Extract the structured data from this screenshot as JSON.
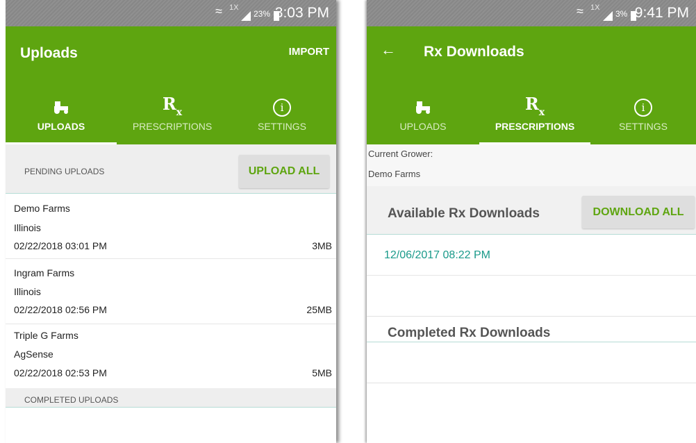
{
  "left": {
    "status": {
      "network": "1X",
      "battery": "23%",
      "time": "3:03 PM"
    },
    "title": "Uploads",
    "import_label": "IMPORT",
    "tabs": [
      {
        "label": "UPLOADS",
        "icon": "tractor-icon",
        "active": true
      },
      {
        "label": "PRESCRIPTIONS",
        "icon": "rx-icon",
        "active": false
      },
      {
        "label": "SETTINGS",
        "icon": "info-icon",
        "active": false
      }
    ],
    "rx_symbol": "R",
    "rx_sub": "x",
    "info_symbol": "i",
    "pending_label": "PENDING UPLOADS",
    "upload_all_label": "UPLOAD ALL",
    "uploads": [
      {
        "farm": "Demo Farms",
        "location": "Illinois",
        "datetime": "02/22/2018 03:01 PM",
        "size": "3MB"
      },
      {
        "farm": "Ingram Farms",
        "location": "Illinois",
        "datetime": "02/22/2018 02:56 PM",
        "size": "25MB"
      },
      {
        "farm": "Triple G Farms",
        "location": "AgSense",
        "datetime": "02/22/2018 02:53 PM",
        "size": "5MB"
      }
    ],
    "completed_label": "COMPLETED UPLOADS"
  },
  "right": {
    "status": {
      "network": "1X",
      "battery": "3%",
      "time": "9:41 PM"
    },
    "back_symbol": "←",
    "title": "Rx Downloads",
    "tabs": [
      {
        "label": "UPLOADS",
        "icon": "tractor-icon",
        "active": false
      },
      {
        "label": "PRESCRIPTIONS",
        "icon": "rx-icon",
        "active": true
      },
      {
        "label": "SETTINGS",
        "icon": "info-icon",
        "active": false
      }
    ],
    "rx_symbol": "R",
    "rx_sub": "x",
    "info_symbol": "i",
    "current_grower_label": "Current Grower:",
    "current_grower": "Demo Farms",
    "available_label": "Available Rx Downloads",
    "download_all_label": "DOWNLOAD ALL",
    "available_items": [
      "12/06/2017 08:22 PM"
    ],
    "completed_label": "Completed Rx Downloads"
  },
  "colors": {
    "brand_green": "#5ea510",
    "teal_link": "#1a9a8a",
    "status_grey": "#8a8a8a"
  }
}
